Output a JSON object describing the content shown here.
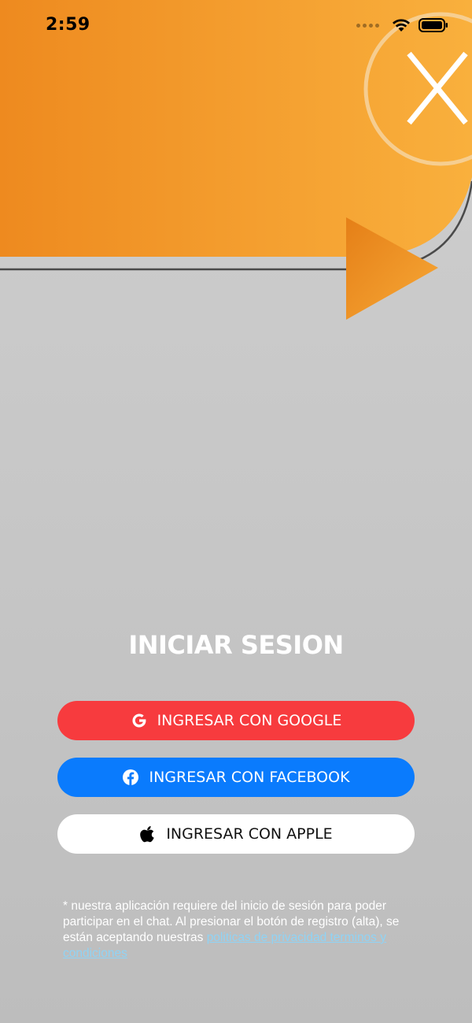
{
  "status_bar": {
    "time": "2:59"
  },
  "hero": {
    "logo_icon": "x-circle-icon",
    "play_icon": "play-triangle-icon",
    "colors": {
      "orange_start": "#f0891f",
      "orange_end": "#f9ae3c"
    }
  },
  "login": {
    "title": "INICIAR SESION",
    "google_label": "INGRESAR CON GOOGLE",
    "facebook_label": "INGRESAR CON FACEBOOK",
    "apple_label": "INGRESAR CON APPLE",
    "colors": {
      "google": "#f73b3e",
      "facebook": "#0a7bfd",
      "apple": "#ffffff"
    }
  },
  "disclaimer": {
    "text": "* nuestra aplicación requiere del inicio de sesión para poder participar en el chat. Al presionar el botón de registro (alta), se están aceptando nuestras ",
    "link_text": "politicas de privacidad terminos y condiciones "
  }
}
